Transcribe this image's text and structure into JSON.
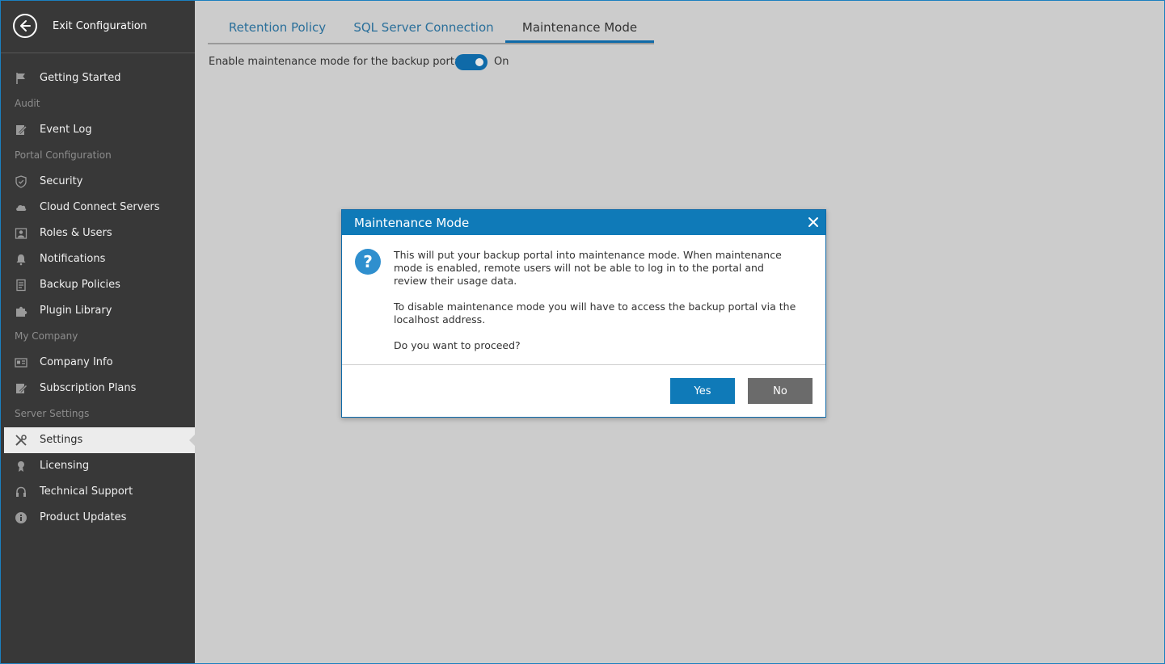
{
  "sidebar": {
    "exit_label": "Exit Configuration",
    "items": [
      {
        "type": "item",
        "label": "Getting Started",
        "icon": "flag-icon",
        "name": "sidebar-item-getting-started"
      },
      {
        "type": "section",
        "label": "Audit",
        "name": "sidebar-section-audit"
      },
      {
        "type": "item",
        "label": "Event Log",
        "icon": "event-log-icon",
        "name": "sidebar-item-event-log"
      },
      {
        "type": "section",
        "label": "Portal Configuration",
        "name": "sidebar-section-portal-configuration"
      },
      {
        "type": "item",
        "label": "Security",
        "icon": "shield-icon",
        "name": "sidebar-item-security"
      },
      {
        "type": "item",
        "label": "Cloud Connect Servers",
        "icon": "cloud-icon",
        "name": "sidebar-item-cloud-connect-servers"
      },
      {
        "type": "item",
        "label": "Roles & Users",
        "icon": "user-card-icon",
        "name": "sidebar-item-roles-users"
      },
      {
        "type": "item",
        "label": "Notifications",
        "icon": "bell-icon",
        "name": "sidebar-item-notifications"
      },
      {
        "type": "item",
        "label": "Backup Policies",
        "icon": "document-icon",
        "name": "sidebar-item-backup-policies"
      },
      {
        "type": "item",
        "label": "Plugin Library",
        "icon": "puzzle-icon",
        "name": "sidebar-item-plugin-library"
      },
      {
        "type": "section",
        "label": "My Company",
        "name": "sidebar-section-my-company"
      },
      {
        "type": "item",
        "label": "Company Info",
        "icon": "id-card-icon",
        "name": "sidebar-item-company-info"
      },
      {
        "type": "item",
        "label": "Subscription Plans",
        "icon": "pen-document-icon",
        "name": "sidebar-item-subscription-plans"
      },
      {
        "type": "section",
        "label": "Server Settings",
        "name": "sidebar-section-server-settings"
      },
      {
        "type": "item",
        "label": "Settings",
        "icon": "tools-icon",
        "name": "sidebar-item-settings",
        "active": true
      },
      {
        "type": "item",
        "label": "Licensing",
        "icon": "license-icon",
        "name": "sidebar-item-licensing"
      },
      {
        "type": "item",
        "label": "Technical Support",
        "icon": "headset-icon",
        "name": "sidebar-item-technical-support"
      },
      {
        "type": "item",
        "label": "Product Updates",
        "icon": "info-icon",
        "name": "sidebar-item-product-updates"
      }
    ]
  },
  "tabs": [
    {
      "label": "Retention Policy",
      "active": false
    },
    {
      "label": "SQL Server Connection",
      "active": false
    },
    {
      "label": "Maintenance Mode",
      "active": true
    }
  ],
  "maintenance": {
    "toggle_label": "Enable maintenance mode for the backup portal:",
    "toggle_state": "On"
  },
  "dialog": {
    "title": "Maintenance Mode",
    "paragraph1": "This will put your backup portal into maintenance mode. When maintenance mode is enabled, remote users will not be able to log in to the portal and review their usage data.",
    "paragraph2": "To disable maintenance mode you will have to access the backup portal via the localhost address.",
    "paragraph3": "Do you want to proceed?",
    "yes_label": "Yes",
    "no_label": "No",
    "icon": "question-icon"
  },
  "colors": {
    "accent": "#0f7ab8",
    "sidebar_bg": "#383838",
    "content_bg": "#cccccc"
  }
}
